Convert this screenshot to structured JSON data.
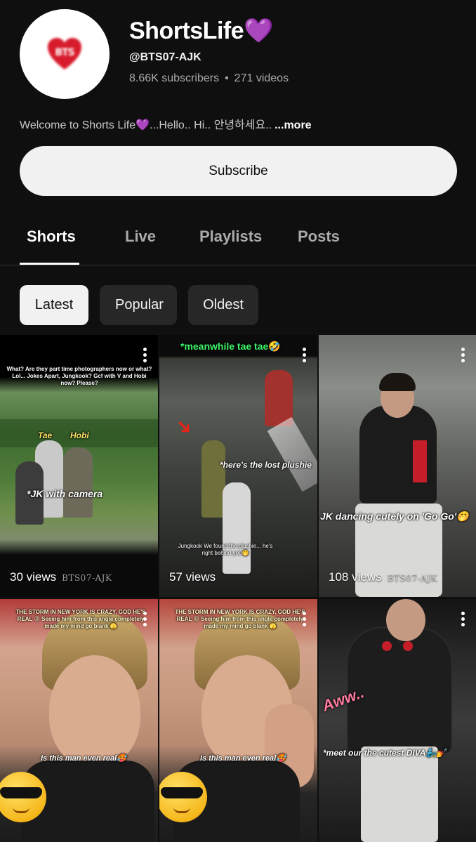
{
  "channel": {
    "name": "ShortsLife💜",
    "handle": "@BTS07-AJK",
    "subscribers": "8.66K subscribers",
    "videos": "271 videos",
    "separator": "•",
    "description": "Welcome to Shorts Life💜...Hello.. Hi.. 안녕하세요..",
    "more_label": "...more",
    "avatar_mark": "BTS"
  },
  "subscribe_label": "Subscribe",
  "tabs": [
    {
      "label": "Shorts",
      "active": true
    },
    {
      "label": "Live"
    },
    {
      "label": "Playlists"
    },
    {
      "label": "Posts"
    }
  ],
  "chips": [
    {
      "label": "Latest",
      "selected": true
    },
    {
      "label": "Popular"
    },
    {
      "label": "Oldest"
    }
  ],
  "shorts": [
    {
      "views": "30 views",
      "watermark": "BTS07-AJK",
      "top_text": "What? Are they part time photographers now or what? Lol... Jokes Apart, Jungkook? Gcf with V and Hobi now? Please?",
      "labels": [
        "Tae",
        "Hobi",
        "*JK with camera"
      ]
    },
    {
      "views": "57 views",
      "top_text": "*meanwhile tae tae🤣",
      "labels": [
        "*here's the lost plushie",
        "Jungkook We found the plushie... he's right behind you🤭"
      ]
    },
    {
      "views": "108 views",
      "watermark": "BTS07-AJK",
      "labels": [
        "JK dancing cutely on 'Go Go'🤭"
      ]
    },
    {
      "views": "",
      "top_text": "THE STORM IN NEW YORK IS CRAZY, GOD HE'S REAL 😩 Seeing him from this angle completely made my mind go blank 🫣",
      "labels": [
        "Is this man even real🥵"
      ]
    },
    {
      "views": "",
      "top_text": "THE STORM IN NEW YORK IS CRAZY, GOD HE'S REAL 😩 Seeing him from this angle completely made my mind go blank 🫣",
      "labels": [
        "Is this man even real🥵"
      ]
    },
    {
      "views": "",
      "labels": [
        "Aww..",
        "*meet our the cutest DIVA🧞‍♂️💅"
      ]
    }
  ]
}
